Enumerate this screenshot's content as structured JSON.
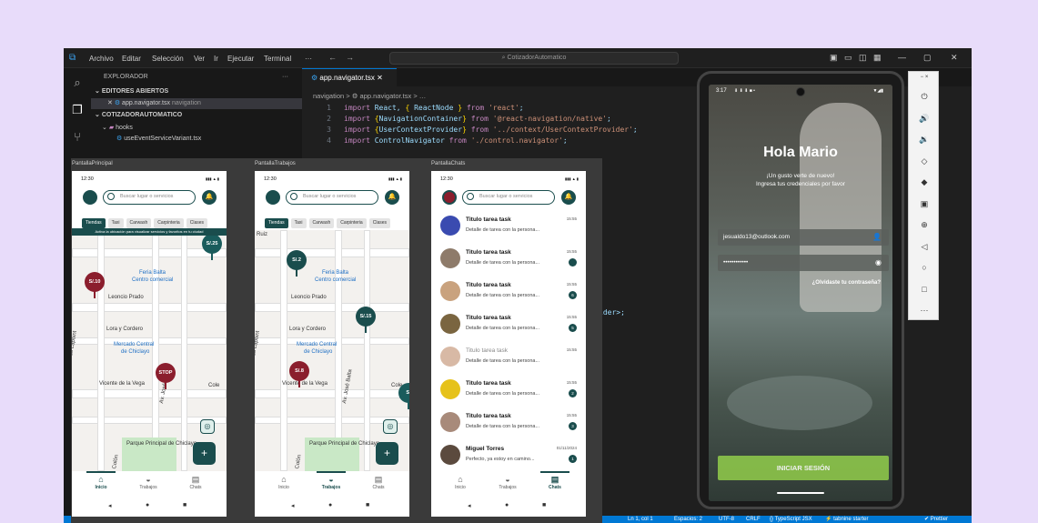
{
  "vscode": {
    "menu": [
      "Archivo",
      "Editar",
      "Selección",
      "Ver",
      "Ir",
      "Ejecutar",
      "Terminal",
      "···"
    ],
    "search_text": "CotizadorAutomatico",
    "explorer_title": "EXPLORADOR",
    "explorer_more": "···",
    "open_editors": "EDITORES ABIERTOS",
    "open_file": "app.navigator.tsx",
    "open_file_path": "navigation",
    "project": "COTIZADORAUTOMATICO",
    "folder_hooks": "hooks",
    "file_hook": "useEventServiceVariant.tsx",
    "tab_label": "app.navigator.tsx",
    "breadcrumb": "navigation > ⚙ app.navigator.tsx > …",
    "code_lines": [
      {
        "n": "1",
        "parts": [
          [
            "kw",
            "import"
          ],
          [
            "id",
            " React, "
          ],
          [
            "br",
            "{"
          ],
          [
            "id",
            " ReactNode "
          ],
          [
            "br",
            "}"
          ],
          [
            "kw",
            " from "
          ],
          [
            "st",
            "'react'"
          ],
          [
            "id",
            ";"
          ]
        ]
      },
      {
        "n": "2",
        "parts": [
          [
            "kw",
            "import"
          ],
          [
            "br",
            " {"
          ],
          [
            "id",
            "NavigationContainer"
          ],
          [
            "br",
            "}"
          ],
          [
            "kw",
            " from "
          ],
          [
            "st",
            "'@react-navigation/native'"
          ],
          [
            "id",
            ";"
          ]
        ]
      },
      {
        "n": "3",
        "parts": [
          [
            "kw",
            "import"
          ],
          [
            "br",
            " {"
          ],
          [
            "id",
            "UserContextProvider"
          ],
          [
            "br",
            "}"
          ],
          [
            "kw",
            " from "
          ],
          [
            "st",
            "'../context/UserContextProvider'"
          ],
          [
            "id",
            ";"
          ]
        ]
      },
      {
        "n": "4",
        "parts": [
          [
            "kw",
            "import"
          ],
          [
            "id",
            " ControlNavigator "
          ],
          [
            "kw",
            "from "
          ],
          [
            "st",
            "'./control.navigator'"
          ],
          [
            "id",
            ";"
          ]
        ]
      }
    ],
    "code_fragment": "ider>;",
    "statusbar": [
      "Ln 1, col 1",
      "Espacios: 2",
      "UTF-8",
      "CRLF",
      "{} TypeScript JSX",
      "⚡ tabnine starter",
      "✔ Prettier"
    ]
  },
  "phones": [
    {
      "label": "PantallaPrincipal",
      "type": "map",
      "active_tab": 0
    },
    {
      "label": "PantallaTrabajos",
      "type": "map",
      "active_tab": 1
    },
    {
      "label": "PantallaChats",
      "type": "chat",
      "active_tab": 2
    }
  ],
  "phone_common": {
    "time": "12:30",
    "signal": "▮▮▮ ▲ ▮",
    "search_placeholder": "Buscar lugar o servicios",
    "chips": [
      "Tiendas",
      "Taxi",
      "Carwash",
      "Carpinteria",
      "Clases"
    ],
    "banner": "Activa la ubicación para visualizar servicios y favoritos en tu ciudad",
    "tabs": [
      "Inicio",
      "Trabajos",
      "Chats"
    ]
  },
  "map_labels": {
    "street_ruiz": "Ruiz",
    "feria": "Feria Balta",
    "feria_sub": "Centro comercial",
    "leoncio": "Leoncio Prado",
    "lora": "Lora y Cordero",
    "mercado": "Mercado Central",
    "mercado_sub": "de Chiclayo",
    "vicente": "Vicente de la Vega",
    "lapoint": "Alfredo Lapoint",
    "balta": "Av. José Balta",
    "parque": "Parque Principal de Chiclayo",
    "colon": "Colón",
    "cole": "Cole"
  },
  "pins1": [
    "S/.25",
    "S/.10",
    "STOP"
  ],
  "pins2": [
    "S/.2",
    "S/.15",
    "S/.8",
    "S/"
  ],
  "chats": [
    {
      "title": "Titulo tarea task",
      "desc": "Detalle de tarea con la persona...",
      "time": "15:55",
      "count": "",
      "color": "#3a4bb0",
      "dim": false
    },
    {
      "title": "Titulo tarea task",
      "desc": "Detalle de tarea con la persona...",
      "time": "15:55",
      "count": "",
      "color": "#8e7b6a",
      "dim": false
    },
    {
      "title": "Titulo tarea task",
      "desc": "Detalle de tarea con la persona...",
      "time": "15:55",
      "count": "6",
      "color": "#c9a27e",
      "dim": false
    },
    {
      "title": "Titulo tarea task",
      "desc": "Detalle de tarea con la persona...",
      "time": "15:55",
      "count": "5",
      "color": "#7a6540",
      "dim": false
    },
    {
      "title": "Titulo tarea task",
      "desc": "Detalle de tarea con la persona...",
      "time": "15:55",
      "count": "",
      "color": "#d8b9a5",
      "dim": true
    },
    {
      "title": "Titulo tarea task",
      "desc": "Detalle de tarea con la persona...",
      "time": "15:55",
      "count": "2",
      "color": "#e6c21a",
      "dim": false
    },
    {
      "title": "Titulo tarea task",
      "desc": "Detalle de tarea con la persona...",
      "time": "15:55",
      "count": "3",
      "color": "#a88a7a",
      "dim": false
    },
    {
      "title": "Miguel Torres",
      "desc": "Perfecto, ya estoy en camino...",
      "time": "01/11/2024",
      "count": "1",
      "color": "#5b4a3e",
      "dim": false
    }
  ],
  "emulator": {
    "time": "3:17",
    "status_icons": "⬇ ⬇ ⬇ ■ •",
    "status_right": "▼◢▮",
    "title": "Hola Mario",
    "subtitle1": "¡Un gusto verte de nuevo!",
    "subtitle2": "Ingresa tus credenciales por favor",
    "email": "jesualdo13@outlook.com",
    "password": "••••••••••••",
    "forgot": "¿Olvidaste tu contraseña?",
    "login": "INICIAR SESIÓN"
  },
  "emulator_tools": [
    "−  ×",
    "⏻",
    "🔊",
    "🔉",
    "◇",
    "◆",
    "▣",
    "⊕",
    "◁",
    "○",
    "□",
    "···"
  ]
}
